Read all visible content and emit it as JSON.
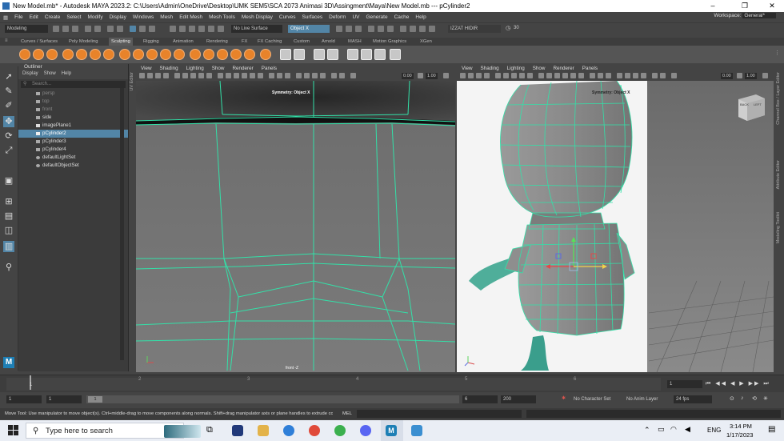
{
  "window": {
    "title": "New Model.mb* - Autodesk MAYA 2023.2: C:\\Users\\Admin\\OneDrive\\Desktop\\UMK SEM5\\SCA 2073 Animasi 3D\\Assingment\\Maya\\New Model.mb  ---  pCylinder2",
    "minimize": "–",
    "maximize": "❐",
    "close": "✕"
  },
  "menubar": {
    "items": [
      "File",
      "Edit",
      "Create",
      "Select",
      "Modify",
      "Display",
      "Windows",
      "Mesh",
      "Edit Mesh",
      "Mesh Tools",
      "Mesh Display",
      "Curves",
      "Surfaces",
      "Deform",
      "UV",
      "Generate",
      "Cache",
      "Help"
    ],
    "workspace_label": "Workspace:",
    "workspace_value": "General*"
  },
  "statusline": {
    "mode": "Modeling",
    "live_surface": "No Live Surface",
    "symmetry": "Object X",
    "user": "IZZAT HIDIR",
    "count": "30"
  },
  "shelf": {
    "tabs": [
      "Curves / Surfaces",
      "Poly Modeling",
      "Sculpting",
      "Rigging",
      "Animation",
      "Rendering",
      "FX",
      "FX Caching",
      "Custom",
      "Arnold",
      "MASH",
      "Motion Graphics",
      "XGen"
    ],
    "active_tab": "Sculpting"
  },
  "outliner": {
    "title": "Outliner",
    "menus": [
      "Display",
      "Show",
      "Help"
    ],
    "search_placeholder": "Search...",
    "items": [
      {
        "label": "persp",
        "dim": true
      },
      {
        "label": "top",
        "dim": true
      },
      {
        "label": "front",
        "dim": true
      },
      {
        "label": "side",
        "dim": false
      },
      {
        "label": "imagePlane1",
        "dim": false
      },
      {
        "label": "pCylinder2",
        "dim": false,
        "selected": true
      },
      {
        "label": "pCylinder3",
        "dim": false
      },
      {
        "label": "pCylinder4",
        "dim": false
      },
      {
        "label": "defaultLightSet",
        "dim": false
      },
      {
        "label": "defaultObjectSet",
        "dim": false
      }
    ]
  },
  "viewport_left": {
    "menus": [
      "View",
      "Shading",
      "Lighting",
      "Show",
      "Renderer",
      "Panels"
    ],
    "val1": "0.00",
    "val2": "1.00",
    "symmetry_label": "Symmetry: Object X",
    "camera_label": "front -Z"
  },
  "viewport_right": {
    "menus": [
      "View",
      "Shading",
      "Lighting",
      "Show",
      "Renderer",
      "Panels"
    ],
    "val1": "0.00",
    "val2": "1.00",
    "symmetry_label": "Symmetry: Object X",
    "viewcube_back": "BACK",
    "viewcube_left": "LEFT"
  },
  "side_tabs": [
    "UV Editor",
    "Channel Box / Layer Editor",
    "Attribute Editor",
    "Modeling Toolkit"
  ],
  "timeslider": {
    "ticks": [
      "1",
      "2",
      "3",
      "4",
      "5",
      "6"
    ],
    "current_frame": "1"
  },
  "rangebar": {
    "start": "1",
    "start2": "1",
    "marker": "1",
    "end_inner": "6",
    "end_outer": "200",
    "character_set": "No Character Set",
    "anim_layer": "No Anim Layer",
    "fps": "24 fps"
  },
  "helpline": {
    "text": "Move Tool: Use manipulator to move object(s). Ctrl+middle-drag to move components along normals. Shift+drag manipulator axis or plane handles to extrude components or c",
    "mel": "MEL"
  },
  "taskbar": {
    "search_placeholder": "Type here to search",
    "language": "ENG",
    "time": "3:14 PM",
    "date": "1/17/2023"
  },
  "colors": {
    "selection": "#5285a6",
    "wire": "#33e0a8",
    "maya_accent": "#e8832a"
  }
}
